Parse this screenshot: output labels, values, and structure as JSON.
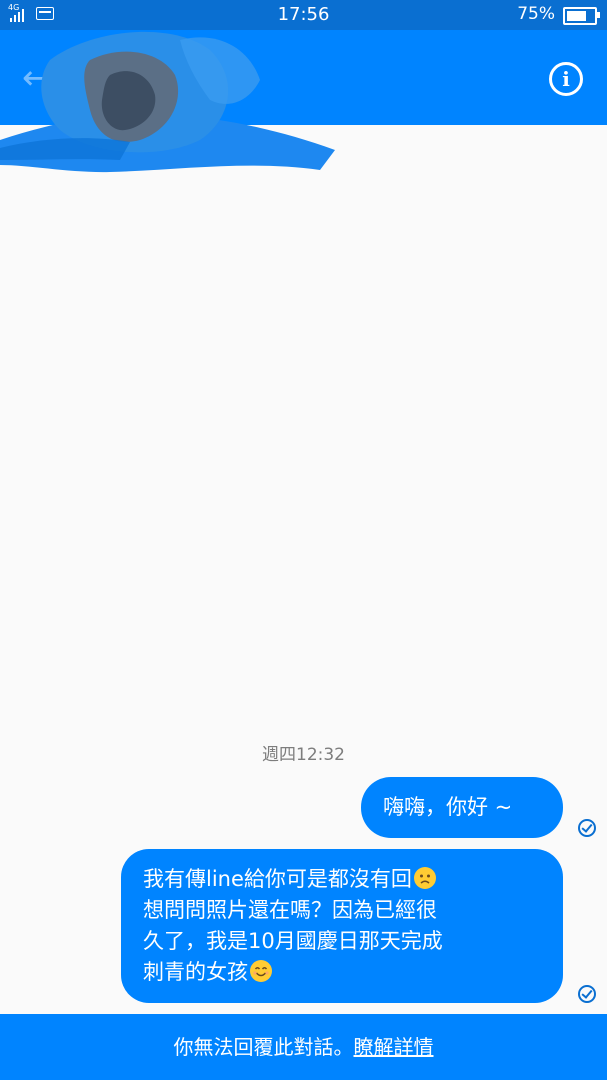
{
  "status_bar": {
    "network": "4G",
    "time": "17:56",
    "battery": "75%",
    "battery_level": 0.75,
    "icons": [
      "signal-icon",
      "sms-icon",
      "battery-icon"
    ]
  },
  "header": {
    "icons": [
      "back-arrow-icon",
      "info-icon"
    ],
    "redacted": true
  },
  "conversation": {
    "timestamp": "週四12:32",
    "messages": [
      {
        "lines": [
          "嗨嗨，你好 ~"
        ],
        "status": "read"
      },
      {
        "lines": [
          "我有傳line給你可是都沒有回",
          "想問問照片還在嗎？因為已經很",
          "久了，我是10月國慶日那天完成",
          "刺青的女孩"
        ],
        "emojis": [
          "sad-face-emoji",
          "smiling-face-emoji"
        ],
        "status": "read"
      }
    ]
  },
  "footer": {
    "notice": "你無法回覆此對話。",
    "link": "瞭解詳情"
  },
  "colors": {
    "brand_blue": "#0084ff",
    "status_bar_blue": "#0a6fd1",
    "background": "#fafafa",
    "timestamp_gray": "#7d7d7d"
  }
}
